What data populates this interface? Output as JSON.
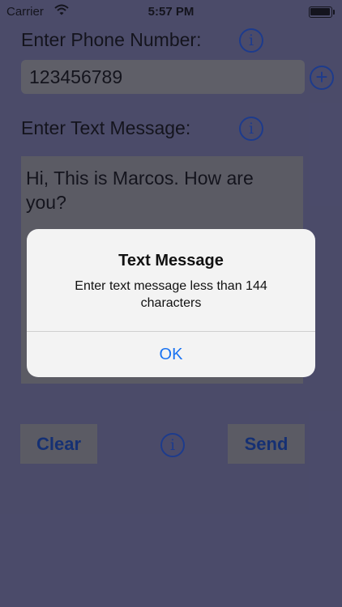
{
  "status_bar": {
    "carrier": "Carrier",
    "time": "5:57 PM",
    "wifi_icon": "wifi-icon",
    "battery_icon": "battery-icon"
  },
  "form": {
    "phone_label": "Enter Phone Number:",
    "phone_value": "123456789",
    "message_label": "Enter Text Message:",
    "message_value": "Hi, This is Marcos.  How are you?",
    "clear_button": "Clear",
    "send_button": "Send",
    "info_glyph": "i",
    "add_glyph": "+"
  },
  "alert": {
    "title": "Text Message",
    "message": "Enter text message less than 144 characters",
    "ok_button": "OK"
  },
  "colors": {
    "background": "#6a6a8c",
    "accent_blue": "#1f4fc4",
    "alert_button": "#1a73f2"
  }
}
